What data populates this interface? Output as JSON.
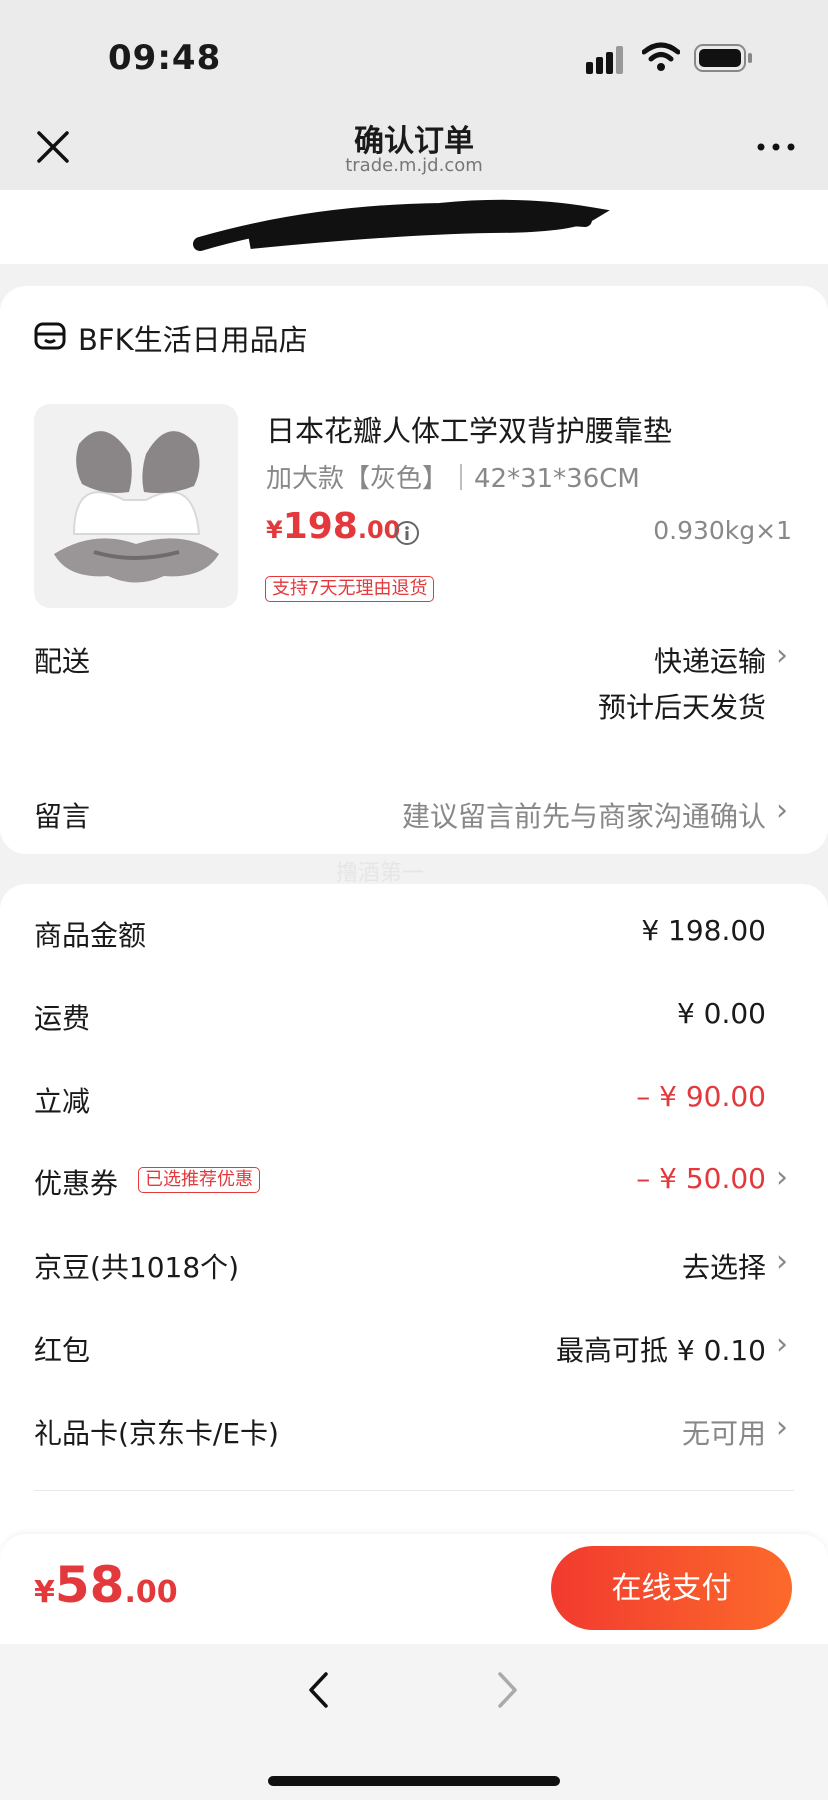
{
  "status_bar": {
    "time": "09:48"
  },
  "header": {
    "title": "确认订单",
    "subtitle": "trade.m.jd.com"
  },
  "shop": {
    "name": "BFK生活日用品店",
    "product": {
      "title": "日本花瓣人体工学双背护腰靠垫",
      "spec": "加大款【灰色】｜42*31*36CM",
      "price_symbol": "¥",
      "price_int": "198",
      "price_dec": ".00",
      "weight_qty": "0.930kg×1",
      "return_tag": "支持7天无理由退货"
    },
    "delivery": {
      "label": "配送",
      "method": "快递运输",
      "eta": "预计后天发货"
    },
    "message": {
      "label": "留言",
      "placeholder": "建议留言前先与商家沟通确认"
    }
  },
  "watermark": "撸酒第一",
  "summary": {
    "goods_amount": {
      "label": "商品金额",
      "value": "¥ 198.00"
    },
    "shipping": {
      "label": "运费",
      "value": "¥ 0.00"
    },
    "discount": {
      "label": "立减",
      "value": "– ¥ 90.00"
    },
    "coupon": {
      "label": "优惠券",
      "tag": "已选推荐优惠",
      "value": "– ¥ 50.00"
    },
    "jd_beans": {
      "label": "京豆(共1018个)",
      "value": "去选择"
    },
    "red_packet": {
      "label": "红包",
      "value": "最高可抵 ¥ 0.10"
    },
    "gift_card": {
      "label": "礼品卡(京东卡/E卡)",
      "value": "无可用"
    }
  },
  "footer": {
    "price_symbol": "¥",
    "total_int": "58",
    "total_dec": ".00",
    "pay_button": "在线支付"
  },
  "colors": {
    "accent_red": "#e4393c",
    "pay_gradient_start": "#f23a2f",
    "pay_gradient_end": "#fc6a2b"
  }
}
